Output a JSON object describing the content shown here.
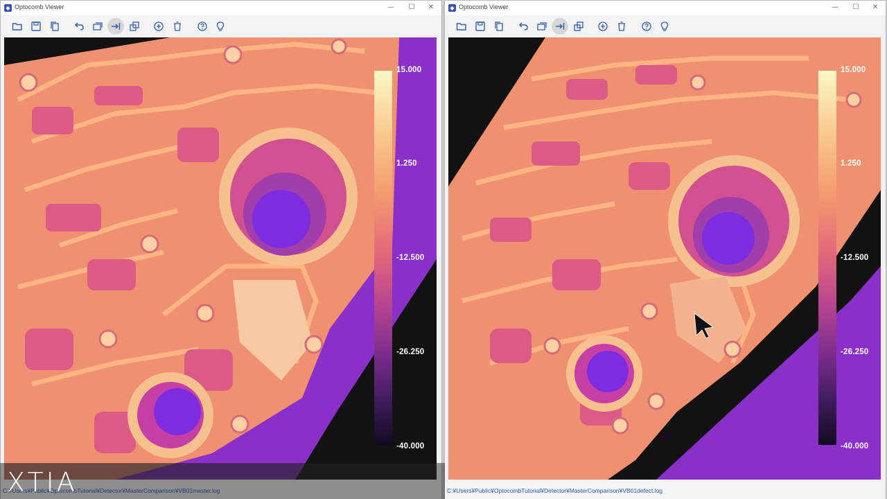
{
  "windows": {
    "left": {
      "title": "Optocomb Viewer",
      "status_path": "C:¥Users¥Public¥OptocombTutorial¥Detector¥MasterComparison¥VB01master.log",
      "colorbar_ticks": [
        "15.000",
        "1.250",
        "-12.500",
        "-26.250",
        "-40.000"
      ]
    },
    "right": {
      "title": "Optocomb Viewer",
      "status_path": "C:¥Users¥Public¥OptocombTutorial¥Detector¥MasterComparison¥VB01defect.log",
      "colorbar_ticks": [
        "15.000",
        "1.250",
        "-12.500",
        "-26.250",
        "-40.000"
      ]
    }
  },
  "toolbar_icons": [
    "open-folder-icon",
    "save-icon",
    "copy-icon",
    "undo-icon",
    "duplicate-icon",
    "align-icon",
    "layers-icon",
    "add-circle-icon",
    "delete-icon",
    "help-icon",
    "lightbulb-icon"
  ],
  "colormap_colors": [
    "#fbf8c4",
    "#f39a6f",
    "#e46b79",
    "#b94690",
    "#7b2d8c",
    "#120a1f"
  ],
  "logo": {
    "text": "XTIA"
  }
}
